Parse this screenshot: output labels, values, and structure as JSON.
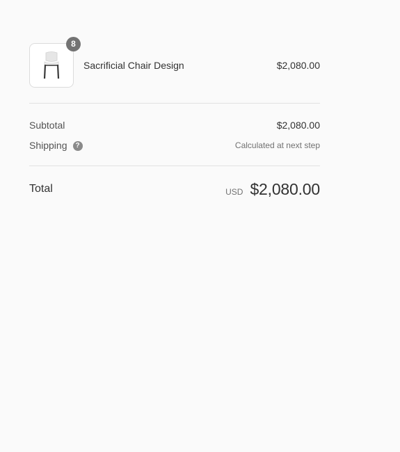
{
  "line_item": {
    "quantity": "8",
    "name": "Sacrificial Chair Design",
    "price": "$2,080.00",
    "thumbnail_icon": "chair-icon"
  },
  "summary": {
    "subtotal_label": "Subtotal",
    "subtotal_value": "$2,080.00",
    "shipping_label": "Shipping",
    "shipping_help_icon": "question-circle-icon",
    "shipping_help_glyph": "?",
    "shipping_value": "Calculated at next step"
  },
  "total": {
    "label": "Total",
    "currency": "USD",
    "value": "$2,080.00"
  },
  "colors": {
    "background": "#fafafa",
    "badge": "#737373",
    "text_dark": "#323232",
    "text_muted": "#717171",
    "divider": "#e1e1e1"
  }
}
